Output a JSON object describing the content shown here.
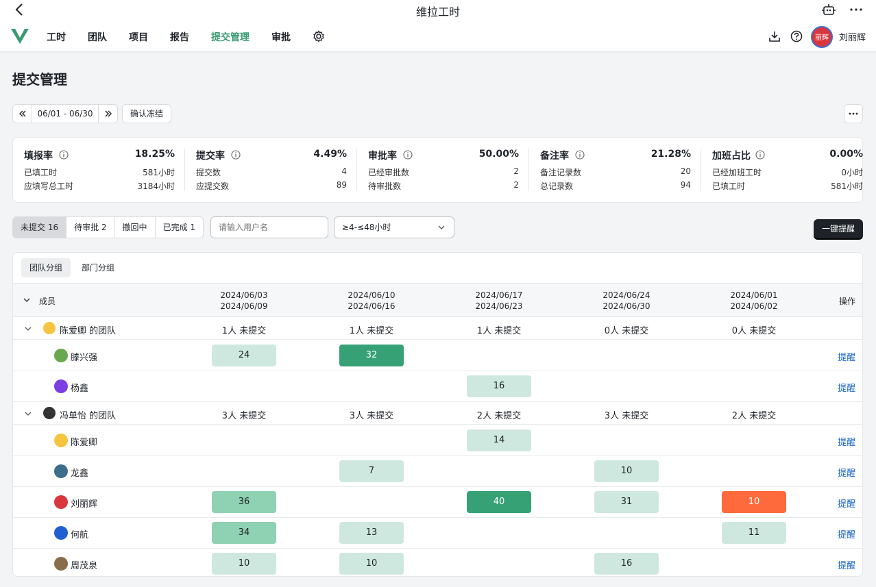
{
  "app": {
    "title": "维拉工时"
  },
  "nav": {
    "items": [
      "工时",
      "团队",
      "项目",
      "报告",
      "提交管理",
      "审批"
    ],
    "active_index": 4,
    "user_name": "刘丽辉",
    "avatar_text": "丽辉"
  },
  "page": {
    "title": "提交管理",
    "date_range": "06/01 - 06/30",
    "freeze_label": "确认冻结"
  },
  "stats": [
    {
      "title": "填报率",
      "pct": "18.25%",
      "l1": "已填工时",
      "v1": "581小时",
      "l2": "应填写总工时",
      "v2": "3184小时"
    },
    {
      "title": "提交率",
      "pct": "4.49%",
      "l1": "提交数",
      "v1": "4",
      "l2": "应提交数",
      "v2": "89"
    },
    {
      "title": "审批率",
      "pct": "50.00%",
      "l1": "已经审批数",
      "v1": "2",
      "l2": "待审批数",
      "v2": "2"
    },
    {
      "title": "备注率",
      "pct": "21.28%",
      "l1": "备注记录数",
      "v1": "20",
      "l2": "总记录数",
      "v2": "94"
    },
    {
      "title": "加班占比",
      "pct": "0.00%",
      "l1": "已经加班工时",
      "v1": "0小时",
      "l2": "已填工时",
      "v2": "581小时"
    }
  ],
  "filters": {
    "tabs": [
      "未提交 16",
      "待审批 2",
      "撤回中",
      "已完成 1"
    ],
    "active_tab": 0,
    "search_placeholder": "请输入用户名",
    "hours_filter": "≥4-≤48小时",
    "remind_all_label": "一键提醒"
  },
  "grouping": {
    "tabs": [
      "团队分组",
      "部门分组"
    ],
    "active": 0
  },
  "table": {
    "member_header": "成员",
    "action_header": "操作",
    "weeks": [
      {
        "start": "2024/06/03",
        "end": "2024/06/09"
      },
      {
        "start": "2024/06/10",
        "end": "2024/06/16"
      },
      {
        "start": "2024/06/17",
        "end": "2024/06/23"
      },
      {
        "start": "2024/06/24",
        "end": "2024/06/30"
      },
      {
        "start": "2024/06/01",
        "end": "2024/06/02"
      }
    ],
    "remind_label": "提醒",
    "groups": [
      {
        "name": "陈爱卿 的团队",
        "avatar_color": "#f5c542",
        "counts": [
          "1人 未提交",
          "1人 未提交",
          "1人 未提交",
          "0人 未提交",
          "0人 未提交"
        ],
        "members": [
          {
            "name": "滕兴强",
            "avatar_color": "#6aa84f",
            "hours": [
              "24",
              "32",
              "",
              "",
              ""
            ],
            "shade": [
              "l",
              "d",
              "",
              "",
              ""
            ]
          },
          {
            "name": "杨鑫",
            "avatar_color": "#7b3fe4",
            "hours": [
              "",
              "",
              "16",
              "",
              ""
            ],
            "shade": [
              "",
              "",
              "l",
              "",
              ""
            ]
          }
        ]
      },
      {
        "name": "冯单怡 的团队",
        "avatar_color": "#333333",
        "counts": [
          "3人 未提交",
          "3人 未提交",
          "2人 未提交",
          "3人 未提交",
          "2人 未提交"
        ],
        "members": [
          {
            "name": "陈爱卿",
            "avatar_color": "#f5c542",
            "hours": [
              "",
              "",
              "14",
              "",
              ""
            ],
            "shade": [
              "",
              "",
              "l",
              "",
              ""
            ]
          },
          {
            "name": "龙鑫",
            "avatar_color": "#3d6f8a",
            "hours": [
              "",
              "7",
              "",
              "10",
              ""
            ],
            "shade": [
              "",
              "l",
              "",
              "l",
              ""
            ]
          },
          {
            "name": "刘丽辉",
            "avatar_color": "#d9363e",
            "hours": [
              "36",
              "",
              "40",
              "31",
              "10"
            ],
            "shade": [
              "m",
              "",
              "d",
              "l",
              "o"
            ]
          },
          {
            "name": "何航",
            "avatar_color": "#1f5fd1",
            "hours": [
              "34",
              "13",
              "",
              "",
              "11"
            ],
            "shade": [
              "m",
              "l",
              "",
              "",
              "l"
            ]
          },
          {
            "name": "周茂泉",
            "avatar_color": "#8a6d4a",
            "hours": [
              "10",
              "10",
              "",
              "16",
              ""
            ],
            "shade": [
              "l",
              "l",
              "",
              "l",
              ""
            ]
          }
        ]
      }
    ]
  }
}
